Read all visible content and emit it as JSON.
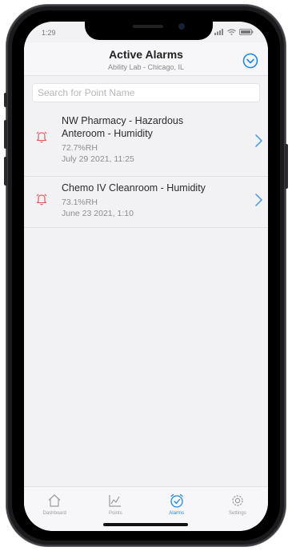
{
  "status_bar": {
    "time": "1:29"
  },
  "header": {
    "title": "Active Alarms",
    "subtitle": "Ability Lab - Chicago, IL"
  },
  "search": {
    "placeholder": "Search for Point Name",
    "value": ""
  },
  "alarms": [
    {
      "title_line1": "NW Pharmacy - Hazardous",
      "title_line2": "Anteroom - Humidity",
      "value": "72.7%RH",
      "date": "July 29 2021, 11:25"
    },
    {
      "title_line1": "Chemo IV Cleanroom - Humidity",
      "value": "73.1%RH",
      "date": "June 23 2021, 1:10"
    }
  ],
  "tabs": [
    {
      "label": "Dashboard",
      "icon": "home-icon"
    },
    {
      "label": "Points",
      "icon": "chart-icon"
    },
    {
      "label": "Alarms",
      "icon": "alarm-clock-icon",
      "active": true
    },
    {
      "label": "Settings",
      "icon": "gear-icon"
    }
  ],
  "colors": {
    "accent": "#1e88e5",
    "alarm": "#e05252"
  }
}
